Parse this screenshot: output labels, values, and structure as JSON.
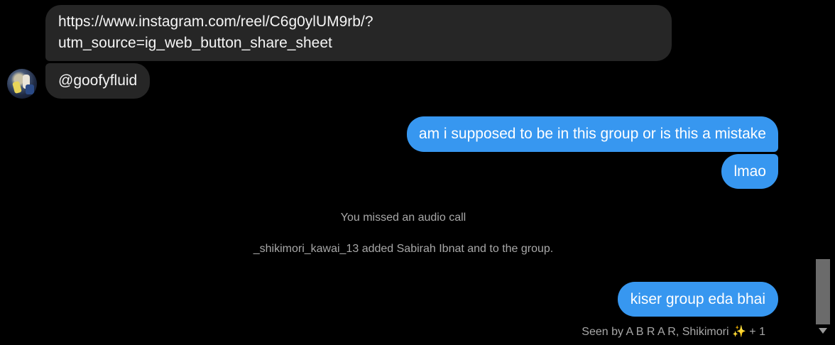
{
  "messages": {
    "link_line1": "https://www.instagram.com/reel/C6g0ylUM9rb/?",
    "link_line2": "utm_source=ig_web_button_share_sheet",
    "mention": "@goofyfluid",
    "out1": "am i supposed to be in this group or is this a mistake",
    "out2": "lmao",
    "out3": "kiser group eda bhai"
  },
  "system": {
    "missed_call": "You missed an audio call",
    "added": "_shikimori_kawai_13 added Sabirah Ibnat and to the group."
  },
  "seen": "Seen by A B R A R, Shikimori ✨ + 1",
  "colors": {
    "background": "#000000",
    "incoming_bubble": "#262626",
    "outgoing_bubble": "#3797f0",
    "system_text": "#a8a8a8"
  },
  "icons": {
    "avatar": "user-avatar",
    "scroll_down": "chevron-down-icon"
  }
}
